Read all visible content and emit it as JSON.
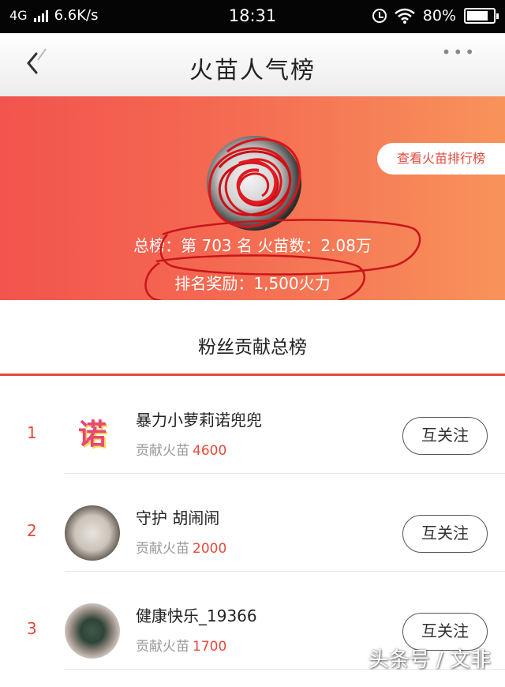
{
  "status_bar": {
    "network": "4G",
    "speed": "6.6K/s",
    "time": "18:31",
    "battery": "80%",
    "battery_level": 0.8
  },
  "nav": {
    "title": "火苗人气榜",
    "more": "•••"
  },
  "banner": {
    "rank_button": "查看火苗排行榜",
    "stats": "总榜：第 703 名   火苗数：2.08万",
    "reward": "排名奖励：1,500火力"
  },
  "section": {
    "title": "粉丝贡献总榜"
  },
  "list": [
    {
      "rank": "1",
      "avatar_text": "诺",
      "name": "暴力小萝莉诺兜兜",
      "contrib_label": "贡献火苗",
      "contrib_value": "4600",
      "button": "互关注"
    },
    {
      "rank": "2",
      "name": "守护 胡闹闹",
      "contrib_label": "贡献火苗",
      "contrib_value": "2000",
      "button": "互关注"
    },
    {
      "rank": "3",
      "name": "健康快乐_19366",
      "contrib_label": "贡献火苗",
      "contrib_value": "1700",
      "button": "互关注"
    }
  ],
  "watermark": "头条号 / 文非",
  "colors": {
    "accent": "#e24a3c",
    "banner_start": "#f2544d",
    "banner_end": "#f8935b"
  }
}
